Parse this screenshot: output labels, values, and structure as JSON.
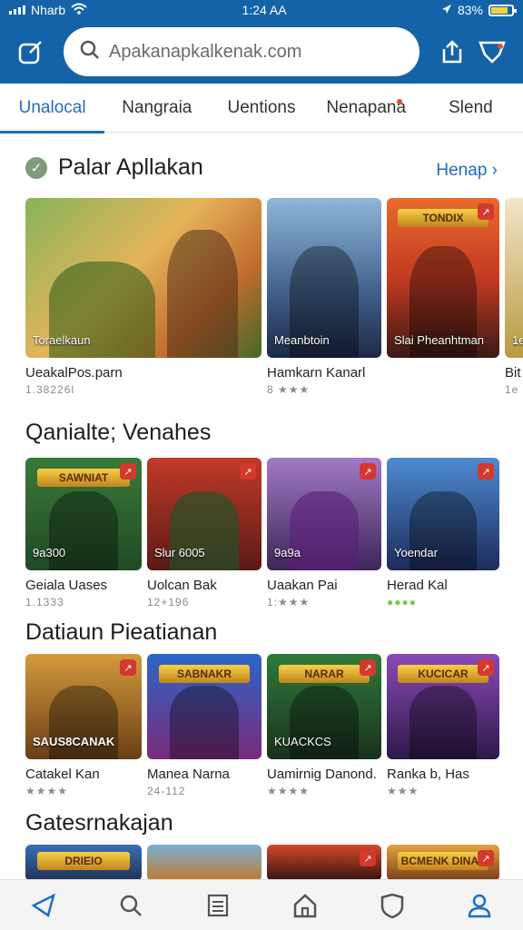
{
  "status": {
    "carrier": "Nharb",
    "time": "1:24 AA",
    "battery": "83%"
  },
  "search": {
    "value": "Apakanapkalkenak.com"
  },
  "tabs": [
    {
      "label": "Unalocal",
      "active": true
    },
    {
      "label": "Nangraia"
    },
    {
      "label": "Uentions"
    },
    {
      "label": "Nenapana",
      "dot": true
    },
    {
      "label": "Slend"
    }
  ],
  "sections": [
    {
      "title": "Palar Apllakan",
      "see_more": "Henap",
      "cards": [
        {
          "caption": "Toraelkaun",
          "name": "UeakalPos.parn",
          "meta": "1.38226l"
        },
        {
          "caption": "Meanbtoin",
          "name": "Hamkarn Kanarl",
          "meta": "8 ★★★"
        },
        {
          "caption": "Slai Pheanhtman",
          "name": "",
          "meta": "",
          "banner": "TONDIX"
        },
        {
          "caption": "1e",
          "name": "Bit",
          "meta": "1e"
        }
      ]
    },
    {
      "title": "Qanialte; Venahes",
      "cards": [
        {
          "caption": "9a300",
          "name": "Geiala Uases",
          "meta": "1.1333",
          "banner": "SAWNIAT"
        },
        {
          "caption": "Slur 6005",
          "name": "Uolcan Bak",
          "meta": "12+196"
        },
        {
          "caption": "9a9a",
          "name": "Uaakan Pai",
          "meta": "1:★★★"
        },
        {
          "caption": "Yoendar",
          "name": "Herad Kal",
          "meta": "●●●●",
          "meta_green": true
        }
      ]
    },
    {
      "title": "Datiaun Pieatianan",
      "cards": [
        {
          "caption": "SAUS8CANAK",
          "name": "Catakel Kan",
          "meta": "★★★★"
        },
        {
          "caption": "",
          "name": "Manea Narna",
          "meta": "24-112",
          "banner": "SABNAKR"
        },
        {
          "caption": "KUACKCS",
          "name": "Uamirnig Danond.",
          "meta": "★★★★",
          "banner": "NARAR"
        },
        {
          "caption": "",
          "name": "Ranka b, Has",
          "meta": "★★★",
          "banner": "KUCICAR"
        }
      ]
    },
    {
      "title": "Gatesrnakajan",
      "cards": [
        {
          "banner": "DRIEIO"
        },
        {},
        {},
        {
          "banner": "BCMENK DINAL"
        }
      ]
    }
  ],
  "nav": [
    "back-icon",
    "search-icon",
    "list-icon",
    "home-icon",
    "shield-icon",
    "profile-icon"
  ]
}
